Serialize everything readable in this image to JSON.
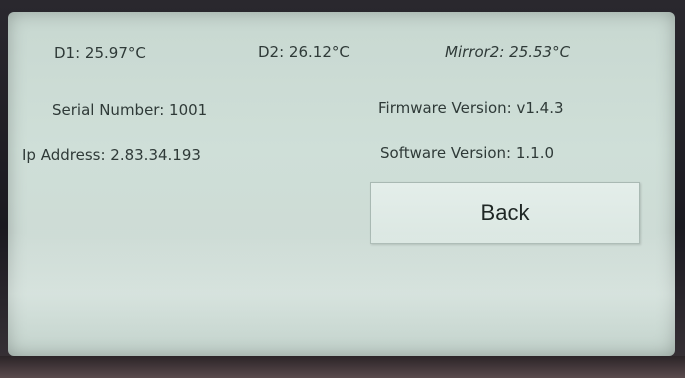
{
  "readings": {
    "d1": "D1: 25.97°C",
    "d2": "D2: 26.12°C",
    "mirror2": "Mirror2: 25.53°C"
  },
  "info": {
    "serial_number": "Serial Number: 1001",
    "firmware_version": "Firmware Version: v1.4.3",
    "ip_address": "Ip Address: 2.83.34.193",
    "software_version": "Software Version: 1.1.0"
  },
  "buttons": {
    "back_label": "Back"
  },
  "colors": {
    "screen_background": "#cfdfd8",
    "text": "#2f3a38",
    "button_background": "#e0ebe6",
    "bezel": "#1d1c22"
  }
}
